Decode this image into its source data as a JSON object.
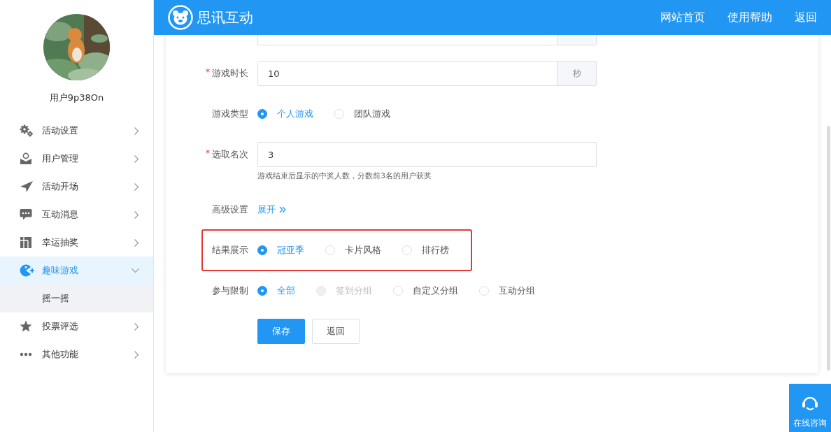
{
  "sidebar": {
    "user_name": "用户9p38On",
    "menu": [
      {
        "label": "活动设置",
        "selected": false,
        "expanded": false
      },
      {
        "label": "用户管理",
        "selected": false,
        "expanded": false
      },
      {
        "label": "活动开场",
        "selected": false,
        "expanded": false
      },
      {
        "label": "互动消息",
        "selected": false,
        "expanded": false
      },
      {
        "label": "幸运抽奖",
        "selected": false,
        "expanded": false
      },
      {
        "label": "趣味游戏",
        "selected": true,
        "expanded": true,
        "children": [
          {
            "label": "摇一摇",
            "selected": false
          }
        ]
      },
      {
        "label": "投票评选",
        "selected": false,
        "expanded": false
      },
      {
        "label": "其他功能",
        "selected": false,
        "expanded": false
      }
    ]
  },
  "header": {
    "brand": "思讯互动",
    "links": [
      "网站首页",
      "使用帮助",
      "返回"
    ]
  },
  "form": {
    "rows": [
      {
        "kind": "cut_input"
      },
      {
        "kind": "input",
        "required_mark": "*",
        "label": "游戏时长",
        "value": "10",
        "suffix": "秒"
      },
      {
        "kind": "radio",
        "label": "游戏类型",
        "highlighted": false,
        "options": [
          {
            "label": "个人游戏",
            "selected": true,
            "disabled": false
          },
          {
            "label": "团队游戏",
            "selected": false,
            "disabled": false
          }
        ]
      },
      {
        "kind": "input",
        "required_mark": "*",
        "label": "选取名次",
        "value": "3",
        "hint": "游戏结束后显示的中奖人数，分数前3名的用户获奖"
      },
      {
        "kind": "expand",
        "label": "高级设置",
        "link": "展开"
      },
      {
        "kind": "radio",
        "label": "结果展示",
        "highlighted": true,
        "options": [
          {
            "label": "冠亚季",
            "selected": true,
            "disabled": false
          },
          {
            "label": "卡片风格",
            "selected": false,
            "disabled": false
          },
          {
            "label": "排行榜",
            "selected": false,
            "disabled": false
          }
        ]
      },
      {
        "kind": "radio",
        "label": "参与限制",
        "highlighted": false,
        "options": [
          {
            "label": "全部",
            "selected": true,
            "disabled": false
          },
          {
            "label": "签到分组",
            "selected": false,
            "disabled": true
          },
          {
            "label": "自定义分组",
            "selected": false,
            "disabled": false
          },
          {
            "label": "互动分组",
            "selected": false,
            "disabled": false
          }
        ]
      },
      {
        "kind": "buttons",
        "buttons": [
          {
            "label": "保存",
            "primary": true
          },
          {
            "label": "返回",
            "primary": false
          }
        ]
      }
    ]
  },
  "support": {
    "label": "在线咨询"
  }
}
